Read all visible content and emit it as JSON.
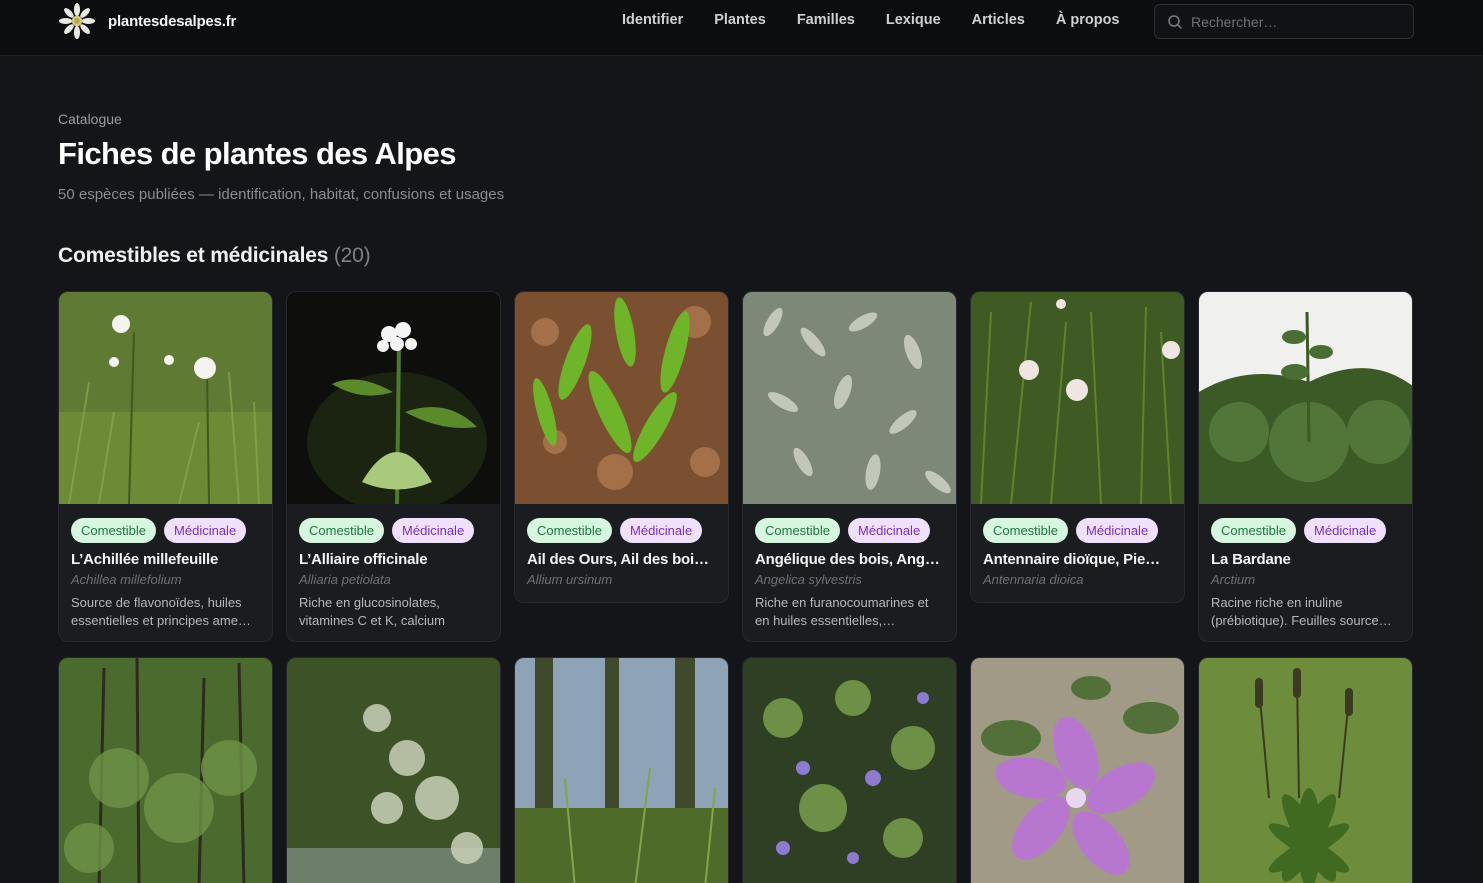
{
  "header": {
    "logo_text": "plantesdesalpes.fr",
    "nav": [
      "Identifier",
      "Plantes",
      "Familles",
      "Lexique",
      "Articles",
      "À propos"
    ],
    "search_placeholder": "Rechercher…"
  },
  "page": {
    "eyebrow": "Catalogue",
    "title": "Fiches de plantes des Alpes",
    "subtitle": "50 espèces publiées — identification, habitat, confusions et usages"
  },
  "section": {
    "title": "Comestibles et médicinales",
    "count": "(20)"
  },
  "tags": {
    "edible": "Comestible",
    "medicinal": "Médicinale"
  },
  "cards": [
    {
      "name": "L’Achillée millefeuille",
      "latin": "Achillea millefolium",
      "desc": "Source de flavonoïdes, huiles essentielles et principes ame…"
    },
    {
      "name": "L’Alliaire officinale",
      "latin": "Alliaria petiolata",
      "desc": "Riche en glucosinolates, vitamines C et K, calcium"
    },
    {
      "name": "Ail des Ours, Ail des boi…",
      "latin": "Allium ursinum",
      "desc": ""
    },
    {
      "name": "Angélique des bois, Ang…",
      "latin": "Angelica sylvestris",
      "desc": "Riche en furanocoumarines et en huiles essentielles,…"
    },
    {
      "name": "Antennaire dioïque, Pie…",
      "latin": "Antennaria dioica",
      "desc": ""
    },
    {
      "name": "La Bardane",
      "latin": "Arctium",
      "desc": "Racine riche en inuline (prébiotique). Feuilles source…"
    }
  ],
  "colors": {
    "background": "#141518",
    "edible_tag_bg": "#d7f6df",
    "edible_tag_text": "#1c7a3c",
    "medicinal_tag_bg": "#efe1fb",
    "medicinal_tag_text": "#7a2fb8"
  }
}
